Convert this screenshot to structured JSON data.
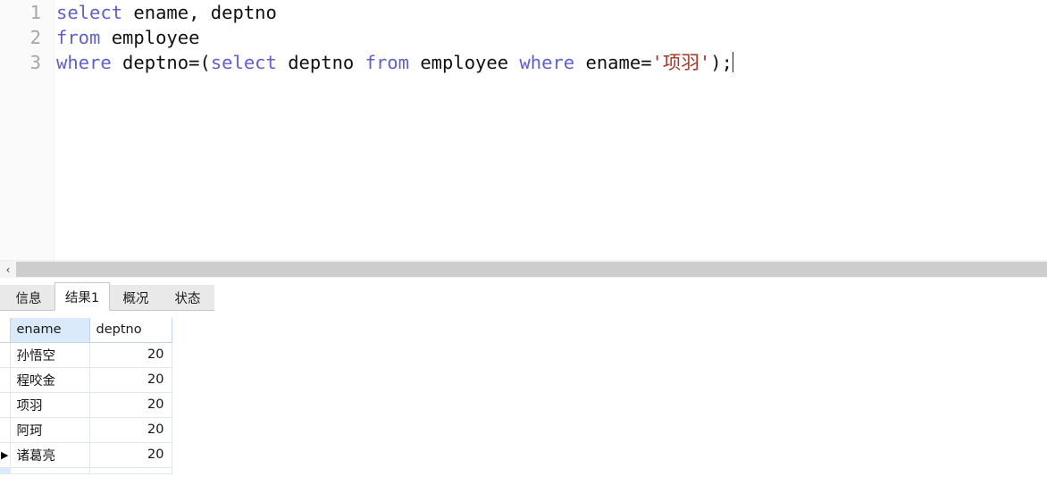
{
  "editor": {
    "lines": [
      {
        "number": "1",
        "tokens": [
          {
            "t": "select",
            "c": "kw"
          },
          {
            "t": " ename, deptno",
            "c": "plain"
          }
        ]
      },
      {
        "number": "2",
        "tokens": [
          {
            "t": "from",
            "c": "kw"
          },
          {
            "t": " employee",
            "c": "plain"
          }
        ]
      },
      {
        "number": "3",
        "tokens": [
          {
            "t": "where",
            "c": "kw"
          },
          {
            "t": " deptno=(",
            "c": "plain"
          },
          {
            "t": "select",
            "c": "kw"
          },
          {
            "t": " deptno ",
            "c": "plain"
          },
          {
            "t": "from",
            "c": "kw"
          },
          {
            "t": " employee ",
            "c": "plain"
          },
          {
            "t": "where",
            "c": "kw"
          },
          {
            "t": " ename=",
            "c": "plain"
          },
          {
            "t": "'项羽'",
            "c": "str"
          },
          {
            "t": ");",
            "c": "plain"
          }
        ]
      }
    ],
    "full_sql": "select ename, deptno\nfrom employee\nwhere deptno=(select deptno from employee where ename='项羽');",
    "caret_visible": true,
    "keyword_color": "#5f5fd3",
    "string_color": "#a93226",
    "text_color": "#101010",
    "lineno_color": "#a6a6a6"
  },
  "scrollbar": {
    "left_arrow_glyph": "‹",
    "orientation": "horizontal",
    "thumb_color": "#cdcdcd",
    "track_color": "#f4f4f4"
  },
  "tabs": {
    "active_index": 1,
    "items": [
      {
        "label": "信息"
      },
      {
        "label": "结果1"
      },
      {
        "label": "概况"
      },
      {
        "label": "状态"
      }
    ]
  },
  "results": {
    "columns": [
      {
        "label": "ename",
        "selected": true
      },
      {
        "label": "deptno",
        "selected": false
      }
    ],
    "rows": [
      {
        "ename": "孙悟空",
        "deptno": "20",
        "current": false
      },
      {
        "ename": "程咬金",
        "deptno": "20",
        "current": false
      },
      {
        "ename": "项羽",
        "deptno": "20",
        "current": false
      },
      {
        "ename": "阿珂",
        "deptno": "20",
        "current": false
      },
      {
        "ename": "诸葛亮",
        "deptno": "20",
        "current": true
      }
    ],
    "current_row_marker": "▶",
    "selected_header_color": "#dbeafa",
    "grid_line_color": "#dfe7ef"
  }
}
